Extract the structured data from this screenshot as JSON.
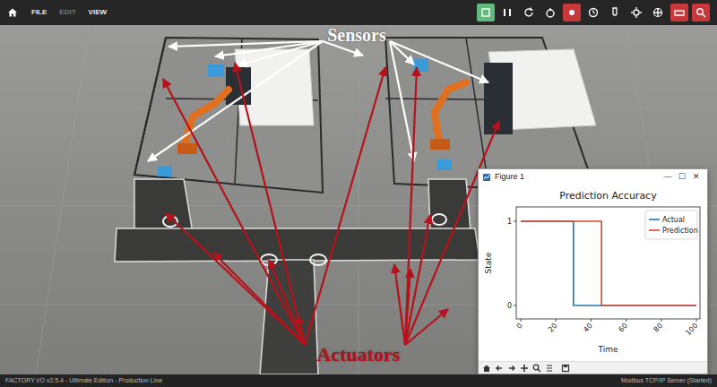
{
  "menu": [
    {
      "label": "FILE",
      "disabled": false
    },
    {
      "label": "EDIT",
      "disabled": true
    },
    {
      "label": "VIEW",
      "disabled": false
    }
  ],
  "toolbar": {
    "buttons": [
      {
        "color": "#62b97c"
      },
      {
        "color": "#262626"
      },
      {
        "color": "#262626"
      },
      {
        "color": "#262626"
      },
      {
        "color": "#c8383a"
      },
      {
        "color": "#262626"
      },
      {
        "color": "#262626"
      },
      {
        "color": "#262626"
      },
      {
        "color": "#262626"
      },
      {
        "color": "#c8383a"
      },
      {
        "color": "#c8383a"
      }
    ]
  },
  "scene": {
    "annotations": [
      {
        "label": "Sensors",
        "color": "#ffffff"
      },
      {
        "label": "Actuators",
        "color": "#b5121b"
      }
    ]
  },
  "figure": {
    "title": "Figure 1",
    "controls": [
      "—",
      "☐",
      "✕"
    ],
    "chart": {
      "title": "Prediction Accuracy",
      "y_label": "State",
      "x_label": "Time",
      "y_ticks": [
        "0",
        "1"
      ],
      "x_ticks": [
        "0",
        "20",
        "40",
        "60",
        "80",
        "100"
      ],
      "series": [
        {
          "label": "Actual",
          "color": "#1f77b4",
          "x": [
            0,
            30,
            30,
            100
          ],
          "y": [
            1,
            1,
            0,
            0
          ]
        },
        {
          "label": "Prediction",
          "color": "#e0452b",
          "x": [
            0,
            46,
            46,
            100
          ],
          "y": [
            1,
            1,
            0,
            0
          ]
        }
      ]
    }
  },
  "status_bar": {
    "left": "FACTORY I/O v2.5.4 - Ultimate Edition - Production Line",
    "right": "Modbus TCP/IP Server (Started)"
  }
}
